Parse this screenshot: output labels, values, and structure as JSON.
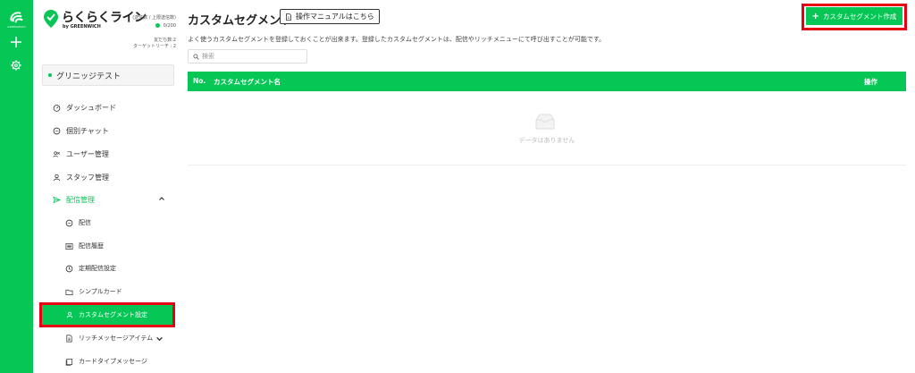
{
  "rail": {
    "logo_text": "GREENWICH",
    "icons": [
      "greenwich-logo-icon",
      "plus-icon",
      "gear-icon"
    ]
  },
  "brand": {
    "title": "らくらくライン",
    "subtitle": "by GREENWICH",
    "stats_label": "(送信数 / 上限送信数)",
    "stats_value": "0/200",
    "friend_count": "友だち数:2",
    "target_reach": "ターゲットリーチ : 2"
  },
  "account": {
    "name": "グリニッジテスト"
  },
  "sidebar": {
    "items": [
      {
        "label": "ダッシュボード",
        "icon": "dashboard-icon"
      },
      {
        "label": "個別チャット",
        "icon": "chat-icon"
      },
      {
        "label": "ユーザー管理",
        "icon": "users-icon"
      },
      {
        "label": "スタッフ管理",
        "icon": "user-icon"
      },
      {
        "label": "配信管理",
        "icon": "send-icon",
        "expanded": true
      }
    ],
    "subitems": [
      {
        "label": "配信",
        "icon": "chat-icon"
      },
      {
        "label": "配信履歴",
        "icon": "list-icon"
      },
      {
        "label": "定期配信設定",
        "icon": "clock-icon"
      },
      {
        "label": "シンプルカード",
        "icon": "folder-icon"
      },
      {
        "label": "カスタムセグメント設定",
        "icon": "user-icon",
        "selected": true
      },
      {
        "label": "リッチメッセージアイテム",
        "icon": "document-icon"
      },
      {
        "label": "カードタイプメッセージ",
        "icon": "card-icon"
      }
    ]
  },
  "main": {
    "title": "カスタムセグメント",
    "manual_label": "操作マニュアルはこちら",
    "create_label": "カスタムセグメント作成",
    "description": "よく使うカスタムセグメントを登録しておくことが出来ます。登録したカスタムセグメントは、配信やリッチメニューにて呼び出すことが可能です。",
    "search_placeholder": "検索",
    "table": {
      "columns": [
        "No.",
        "カスタムセグメント名",
        "操作"
      ],
      "rows": [],
      "empty_text": "データはありません"
    }
  },
  "colors": {
    "brand_green": "#06c755",
    "highlight_red": "#e60012"
  }
}
